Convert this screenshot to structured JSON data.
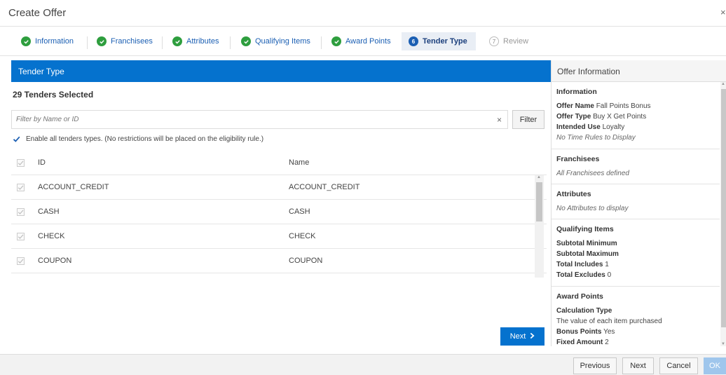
{
  "dialog": {
    "title": "Create Offer",
    "close_glyph": "×"
  },
  "train": {
    "steps": [
      {
        "label": "Information",
        "state": "done"
      },
      {
        "label": "Franchisees",
        "state": "done"
      },
      {
        "label": "Attributes",
        "state": "done"
      },
      {
        "label": "Qualifying Items",
        "state": "done"
      },
      {
        "label": "Award Points",
        "state": "done"
      },
      {
        "label": "Tender Type",
        "state": "current",
        "number": "6"
      },
      {
        "label": "Review",
        "state": "future",
        "number": "7"
      }
    ]
  },
  "tender": {
    "panel_title": "Tender Type",
    "selected_count": "29 Tenders Selected",
    "filter_placeholder": "Filter by Name or ID",
    "filter_clear": "×",
    "filter_button": "Filter",
    "enable_all_label": "Enable all tenders types. (No restrictions will be placed on the eligibility rule.)",
    "enable_all_checked": true,
    "columns": {
      "id": "ID",
      "name": "Name"
    },
    "rows": [
      {
        "id": "ACCOUNT_CREDIT",
        "name": "ACCOUNT_CREDIT"
      },
      {
        "id": "CASH",
        "name": "CASH"
      },
      {
        "id": "CHECK",
        "name": "CHECK"
      },
      {
        "id": "COUPON",
        "name": "COUPON"
      }
    ],
    "next_button": "Next"
  },
  "offer_info": {
    "title": "Offer Information",
    "information": {
      "heading": "Information",
      "offer_name_label": "Offer Name",
      "offer_name_value": "Fall Points Bonus",
      "offer_type_label": "Offer Type",
      "offer_type_value": "Buy X Get Points",
      "intended_use_label": "Intended Use",
      "intended_use_value": "Loyalty",
      "time_rules": "No Time Rules to Display"
    },
    "franchisees": {
      "heading": "Franchisees",
      "text": "All Franchisees defined"
    },
    "attributes": {
      "heading": "Attributes",
      "text": "No Attributes to display"
    },
    "qualifying_items": {
      "heading": "Qualifying Items",
      "subtotal_min_label": "Subtotal Minimum",
      "subtotal_max_label": "Subtotal Maximum",
      "total_includes_label": "Total Includes",
      "total_includes_value": "1",
      "total_excludes_label": "Total Excludes",
      "total_excludes_value": "0"
    },
    "award_points": {
      "heading": "Award Points",
      "calc_type_label": "Calculation Type",
      "calc_type_value": "The value of each item purchased",
      "bonus_points_label": "Bonus Points",
      "bonus_points_value": "Yes",
      "fixed_amount_label": "Fixed Amount",
      "fixed_amount_value": "2"
    }
  },
  "footer": {
    "previous": "Previous",
    "next": "Next",
    "cancel": "Cancel",
    "ok": "OK"
  }
}
